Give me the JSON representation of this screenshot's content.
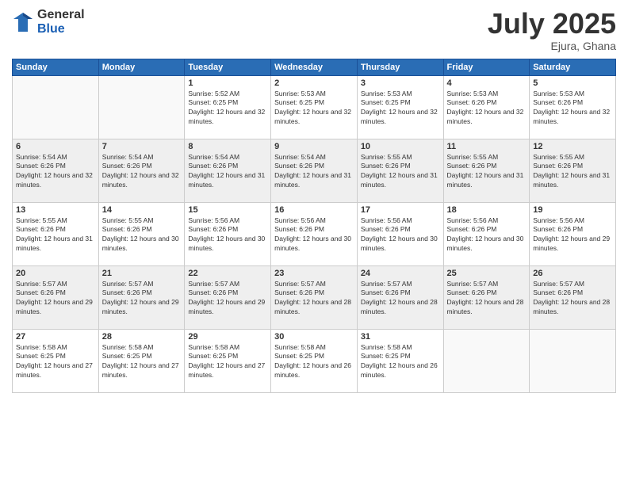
{
  "logo": {
    "general": "General",
    "blue": "Blue"
  },
  "title": {
    "month_year": "July 2025",
    "location": "Ejura, Ghana"
  },
  "days_of_week": [
    "Sunday",
    "Monday",
    "Tuesday",
    "Wednesday",
    "Thursday",
    "Friday",
    "Saturday"
  ],
  "weeks": [
    [
      {
        "day": "",
        "sunrise": "",
        "sunset": "",
        "daylight": ""
      },
      {
        "day": "",
        "sunrise": "",
        "sunset": "",
        "daylight": ""
      },
      {
        "day": "1",
        "sunrise": "Sunrise: 5:52 AM",
        "sunset": "Sunset: 6:25 PM",
        "daylight": "Daylight: 12 hours and 32 minutes."
      },
      {
        "day": "2",
        "sunrise": "Sunrise: 5:53 AM",
        "sunset": "Sunset: 6:25 PM",
        "daylight": "Daylight: 12 hours and 32 minutes."
      },
      {
        "day": "3",
        "sunrise": "Sunrise: 5:53 AM",
        "sunset": "Sunset: 6:25 PM",
        "daylight": "Daylight: 12 hours and 32 minutes."
      },
      {
        "day": "4",
        "sunrise": "Sunrise: 5:53 AM",
        "sunset": "Sunset: 6:26 PM",
        "daylight": "Daylight: 12 hours and 32 minutes."
      },
      {
        "day": "5",
        "sunrise": "Sunrise: 5:53 AM",
        "sunset": "Sunset: 6:26 PM",
        "daylight": "Daylight: 12 hours and 32 minutes."
      }
    ],
    [
      {
        "day": "6",
        "sunrise": "Sunrise: 5:54 AM",
        "sunset": "Sunset: 6:26 PM",
        "daylight": "Daylight: 12 hours and 32 minutes."
      },
      {
        "day": "7",
        "sunrise": "Sunrise: 5:54 AM",
        "sunset": "Sunset: 6:26 PM",
        "daylight": "Daylight: 12 hours and 32 minutes."
      },
      {
        "day": "8",
        "sunrise": "Sunrise: 5:54 AM",
        "sunset": "Sunset: 6:26 PM",
        "daylight": "Daylight: 12 hours and 31 minutes."
      },
      {
        "day": "9",
        "sunrise": "Sunrise: 5:54 AM",
        "sunset": "Sunset: 6:26 PM",
        "daylight": "Daylight: 12 hours and 31 minutes."
      },
      {
        "day": "10",
        "sunrise": "Sunrise: 5:55 AM",
        "sunset": "Sunset: 6:26 PM",
        "daylight": "Daylight: 12 hours and 31 minutes."
      },
      {
        "day": "11",
        "sunrise": "Sunrise: 5:55 AM",
        "sunset": "Sunset: 6:26 PM",
        "daylight": "Daylight: 12 hours and 31 minutes."
      },
      {
        "day": "12",
        "sunrise": "Sunrise: 5:55 AM",
        "sunset": "Sunset: 6:26 PM",
        "daylight": "Daylight: 12 hours and 31 minutes."
      }
    ],
    [
      {
        "day": "13",
        "sunrise": "Sunrise: 5:55 AM",
        "sunset": "Sunset: 6:26 PM",
        "daylight": "Daylight: 12 hours and 31 minutes."
      },
      {
        "day": "14",
        "sunrise": "Sunrise: 5:55 AM",
        "sunset": "Sunset: 6:26 PM",
        "daylight": "Daylight: 12 hours and 30 minutes."
      },
      {
        "day": "15",
        "sunrise": "Sunrise: 5:56 AM",
        "sunset": "Sunset: 6:26 PM",
        "daylight": "Daylight: 12 hours and 30 minutes."
      },
      {
        "day": "16",
        "sunrise": "Sunrise: 5:56 AM",
        "sunset": "Sunset: 6:26 PM",
        "daylight": "Daylight: 12 hours and 30 minutes."
      },
      {
        "day": "17",
        "sunrise": "Sunrise: 5:56 AM",
        "sunset": "Sunset: 6:26 PM",
        "daylight": "Daylight: 12 hours and 30 minutes."
      },
      {
        "day": "18",
        "sunrise": "Sunrise: 5:56 AM",
        "sunset": "Sunset: 6:26 PM",
        "daylight": "Daylight: 12 hours and 30 minutes."
      },
      {
        "day": "19",
        "sunrise": "Sunrise: 5:56 AM",
        "sunset": "Sunset: 6:26 PM",
        "daylight": "Daylight: 12 hours and 29 minutes."
      }
    ],
    [
      {
        "day": "20",
        "sunrise": "Sunrise: 5:57 AM",
        "sunset": "Sunset: 6:26 PM",
        "daylight": "Daylight: 12 hours and 29 minutes."
      },
      {
        "day": "21",
        "sunrise": "Sunrise: 5:57 AM",
        "sunset": "Sunset: 6:26 PM",
        "daylight": "Daylight: 12 hours and 29 minutes."
      },
      {
        "day": "22",
        "sunrise": "Sunrise: 5:57 AM",
        "sunset": "Sunset: 6:26 PM",
        "daylight": "Daylight: 12 hours and 29 minutes."
      },
      {
        "day": "23",
        "sunrise": "Sunrise: 5:57 AM",
        "sunset": "Sunset: 6:26 PM",
        "daylight": "Daylight: 12 hours and 28 minutes."
      },
      {
        "day": "24",
        "sunrise": "Sunrise: 5:57 AM",
        "sunset": "Sunset: 6:26 PM",
        "daylight": "Daylight: 12 hours and 28 minutes."
      },
      {
        "day": "25",
        "sunrise": "Sunrise: 5:57 AM",
        "sunset": "Sunset: 6:26 PM",
        "daylight": "Daylight: 12 hours and 28 minutes."
      },
      {
        "day": "26",
        "sunrise": "Sunrise: 5:57 AM",
        "sunset": "Sunset: 6:26 PM",
        "daylight": "Daylight: 12 hours and 28 minutes."
      }
    ],
    [
      {
        "day": "27",
        "sunrise": "Sunrise: 5:58 AM",
        "sunset": "Sunset: 6:25 PM",
        "daylight": "Daylight: 12 hours and 27 minutes."
      },
      {
        "day": "28",
        "sunrise": "Sunrise: 5:58 AM",
        "sunset": "Sunset: 6:25 PM",
        "daylight": "Daylight: 12 hours and 27 minutes."
      },
      {
        "day": "29",
        "sunrise": "Sunrise: 5:58 AM",
        "sunset": "Sunset: 6:25 PM",
        "daylight": "Daylight: 12 hours and 27 minutes."
      },
      {
        "day": "30",
        "sunrise": "Sunrise: 5:58 AM",
        "sunset": "Sunset: 6:25 PM",
        "daylight": "Daylight: 12 hours and 26 minutes."
      },
      {
        "day": "31",
        "sunrise": "Sunrise: 5:58 AM",
        "sunset": "Sunset: 6:25 PM",
        "daylight": "Daylight: 12 hours and 26 minutes."
      },
      {
        "day": "",
        "sunrise": "",
        "sunset": "",
        "daylight": ""
      },
      {
        "day": "",
        "sunrise": "",
        "sunset": "",
        "daylight": ""
      }
    ]
  ]
}
